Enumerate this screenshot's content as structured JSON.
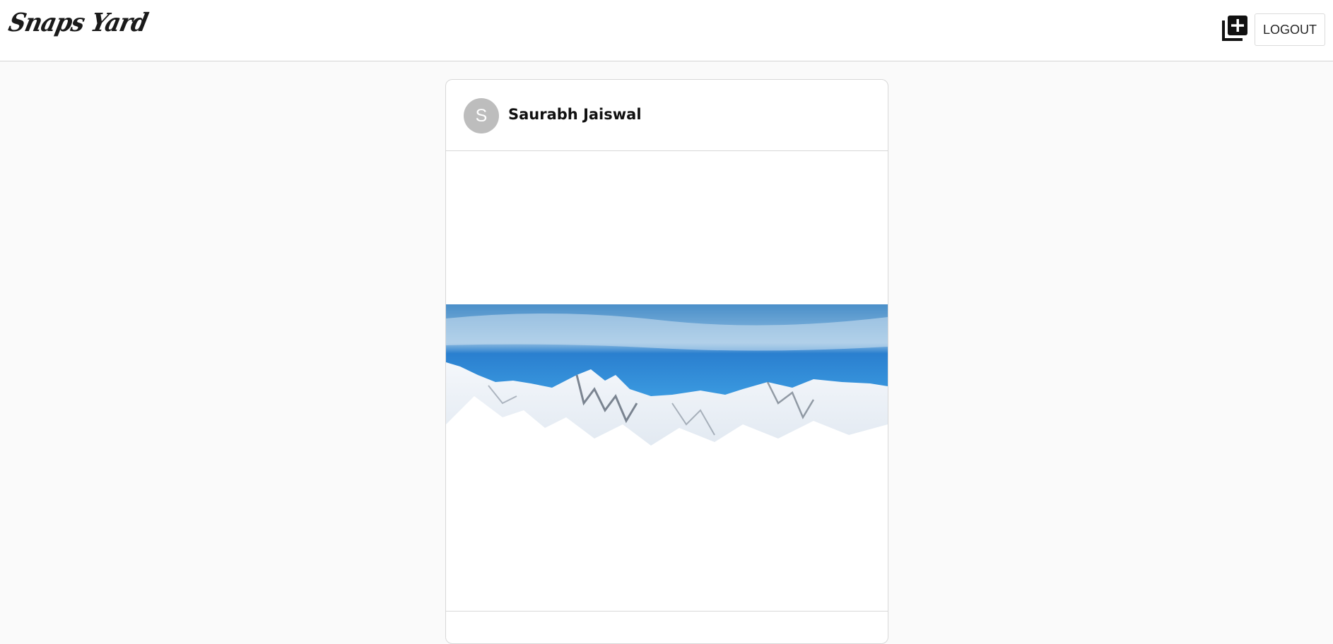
{
  "header": {
    "logo_text": "Snaps Yard",
    "add_post_icon": "add-to-photos-icon",
    "logout_label": "LOGOUT"
  },
  "post": {
    "avatar_initial": "S",
    "username": "Saurabh Jaiswal",
    "image_subject": "snowy-mountain-panorama"
  },
  "colors": {
    "background": "#fafafa",
    "avatar": "#bdbdbd",
    "sky": "#2f8fd6"
  }
}
